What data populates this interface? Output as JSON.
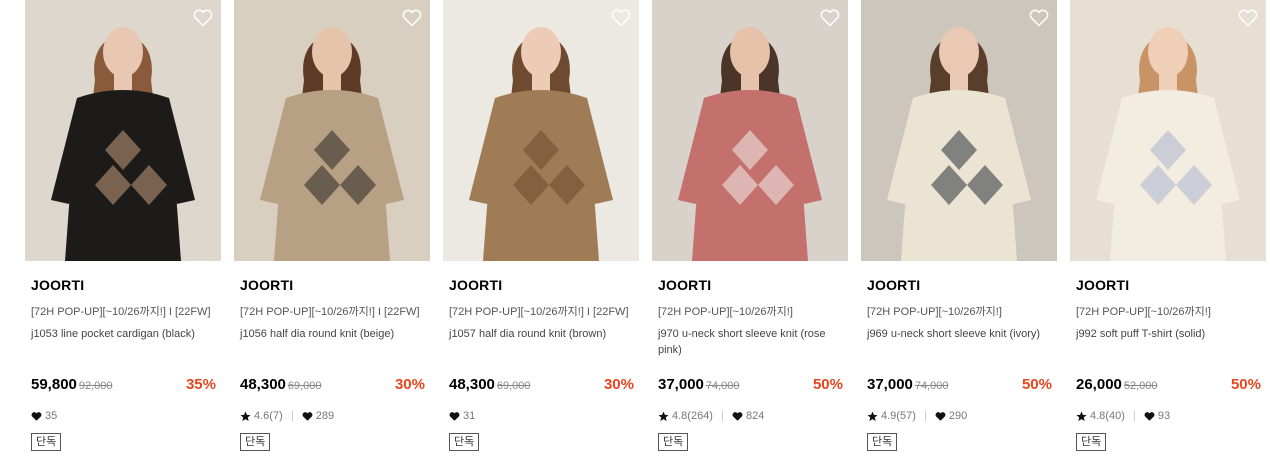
{
  "products": [
    {
      "brand": "JOORTI",
      "promo": "[72H POP-UP][~10/26까지!] I [22FW]",
      "name": "j1053 line pocket cardigan (black)",
      "price": "59,800",
      "original_price": "92,000",
      "discount": "35%",
      "rating": "",
      "likes": "35",
      "tag": "단독",
      "colors": {
        "bg": "#ddd7ce",
        "garment": "#1d1b1a",
        "trim": "#c79d80",
        "skin": "#e8c8b2",
        "hair": "#8a5a3a"
      }
    },
    {
      "brand": "JOORTI",
      "promo": "[72H POP-UP][~10/26까지!] I [22FW]",
      "name": "j1056 half dia round knit (beige)",
      "price": "48,300",
      "original_price": "69,000",
      "discount": "30%",
      "rating": "4.6(7)",
      "likes": "289",
      "tag": "단독",
      "colors": {
        "bg": "#d9cfc0",
        "garment": "#b7a083",
        "trim": "#2a2725",
        "skin": "#e6c4ac",
        "hair": "#5e3b26"
      }
    },
    {
      "brand": "JOORTI",
      "promo": "[72H POP-UP][~10/26까지!] I [22FW]",
      "name": "j1057 half dia round knit (brown)",
      "price": "48,300",
      "original_price": "69,000",
      "discount": "30%",
      "rating": "",
      "likes": "31",
      "tag": "단독",
      "colors": {
        "bg": "#ece8e2",
        "garment": "#a07c56",
        "trim": "#6b4a2c",
        "skin": "#ecccb7",
        "hair": "#6e4a30"
      }
    },
    {
      "brand": "JOORTI",
      "promo": "[72H POP-UP][~10/26까지!]",
      "name": "j970 u-neck short sleeve knit (rose pink)",
      "price": "37,000",
      "original_price": "74,000",
      "discount": "50%",
      "rating": "4.8(264)",
      "likes": "824",
      "tag": "단독",
      "colors": {
        "bg": "#d8d2cb",
        "garment": "#c4706c",
        "trim": "#f2f0ee",
        "skin": "#e7c2aa",
        "hair": "#4b3428"
      }
    },
    {
      "brand": "JOORTI",
      "promo": "[72H POP-UP][~10/26까지!]",
      "name": "j969 u-neck short sleeve knit (ivory)",
      "price": "37,000",
      "original_price": "74,000",
      "discount": "50%",
      "rating": "4.9(57)",
      "likes": "290",
      "tag": "단독",
      "colors": {
        "bg": "#cdc6bc",
        "garment": "#ece4d3",
        "trim": "#2a2f3a",
        "skin": "#e9c9b3",
        "hair": "#5a3e2c"
      }
    },
    {
      "brand": "JOORTI",
      "promo": "[72H POP-UP][~10/26까지!]",
      "name": "j992 soft puff T-shirt (solid)",
      "price": "26,000",
      "original_price": "52,000",
      "discount": "50%",
      "rating": "4.8(40)",
      "likes": "93",
      "tag": "단독",
      "colors": {
        "bg": "#e7dfd4",
        "garment": "#f3ece0",
        "trim": "#a9b4cf",
        "skin": "#efcfb8",
        "hair": "#c89466"
      }
    }
  ]
}
